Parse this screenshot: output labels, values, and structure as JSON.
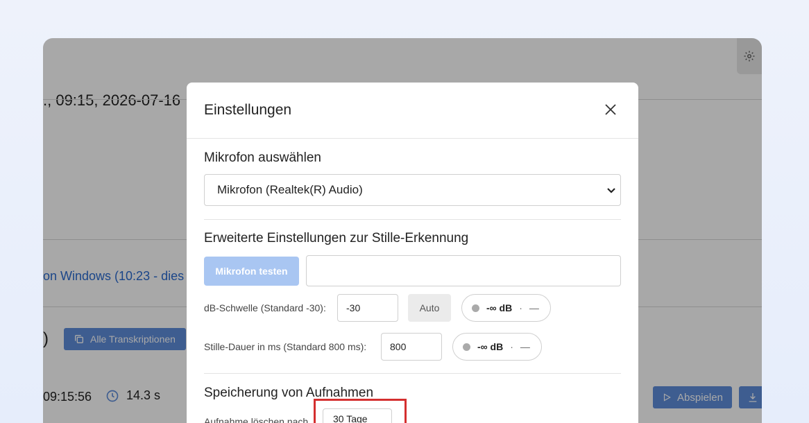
{
  "app": {
    "title": "., 09:15, 2026-07-16",
    "session_link": "on Windows   (10:23 - dies",
    "paren": ")",
    "all_button": "Alle Transkriptionen",
    "row_time": "09:15:56",
    "row_duration": "14.3 s",
    "play_button": "Abspielen"
  },
  "modal": {
    "title": "Einstellungen",
    "mic_section": "Mikrofon auswählen",
    "mic_selected": "Mikrofon (Realtek(R) Audio)",
    "silence_section": "Erweiterte Einstellungen zur Stille-Erkennung",
    "test_button": "Mikrofon testen",
    "db_label": "dB-Schwelle (Standard -30):",
    "db_value": "-30",
    "auto_button": "Auto",
    "meter1_value": "-∞ dB",
    "meter1_sep": "·",
    "meter1_dash": "—",
    "duration_label": "Stille-Dauer in ms (Standard 800 ms):",
    "duration_value": "800",
    "meter2_value": "-∞ dB",
    "meter2_sep": "·",
    "meter2_dash": "—",
    "storage_section": "Speicherung von Aufnahmen",
    "delete_label": "Aufnahme löschen nach",
    "delete_selected": "30 Tage"
  },
  "colors": {
    "accent": "#5f8ddb",
    "highlight": "#d42f2f",
    "test_button_bg": "#a9c6f2"
  },
  "icons": {
    "gear": "gear-icon",
    "close": "close-icon",
    "copy": "copy-icon",
    "clock": "clock-icon",
    "play": "play-icon",
    "download": "download-icon",
    "chevron": "chevron-down-icon"
  }
}
